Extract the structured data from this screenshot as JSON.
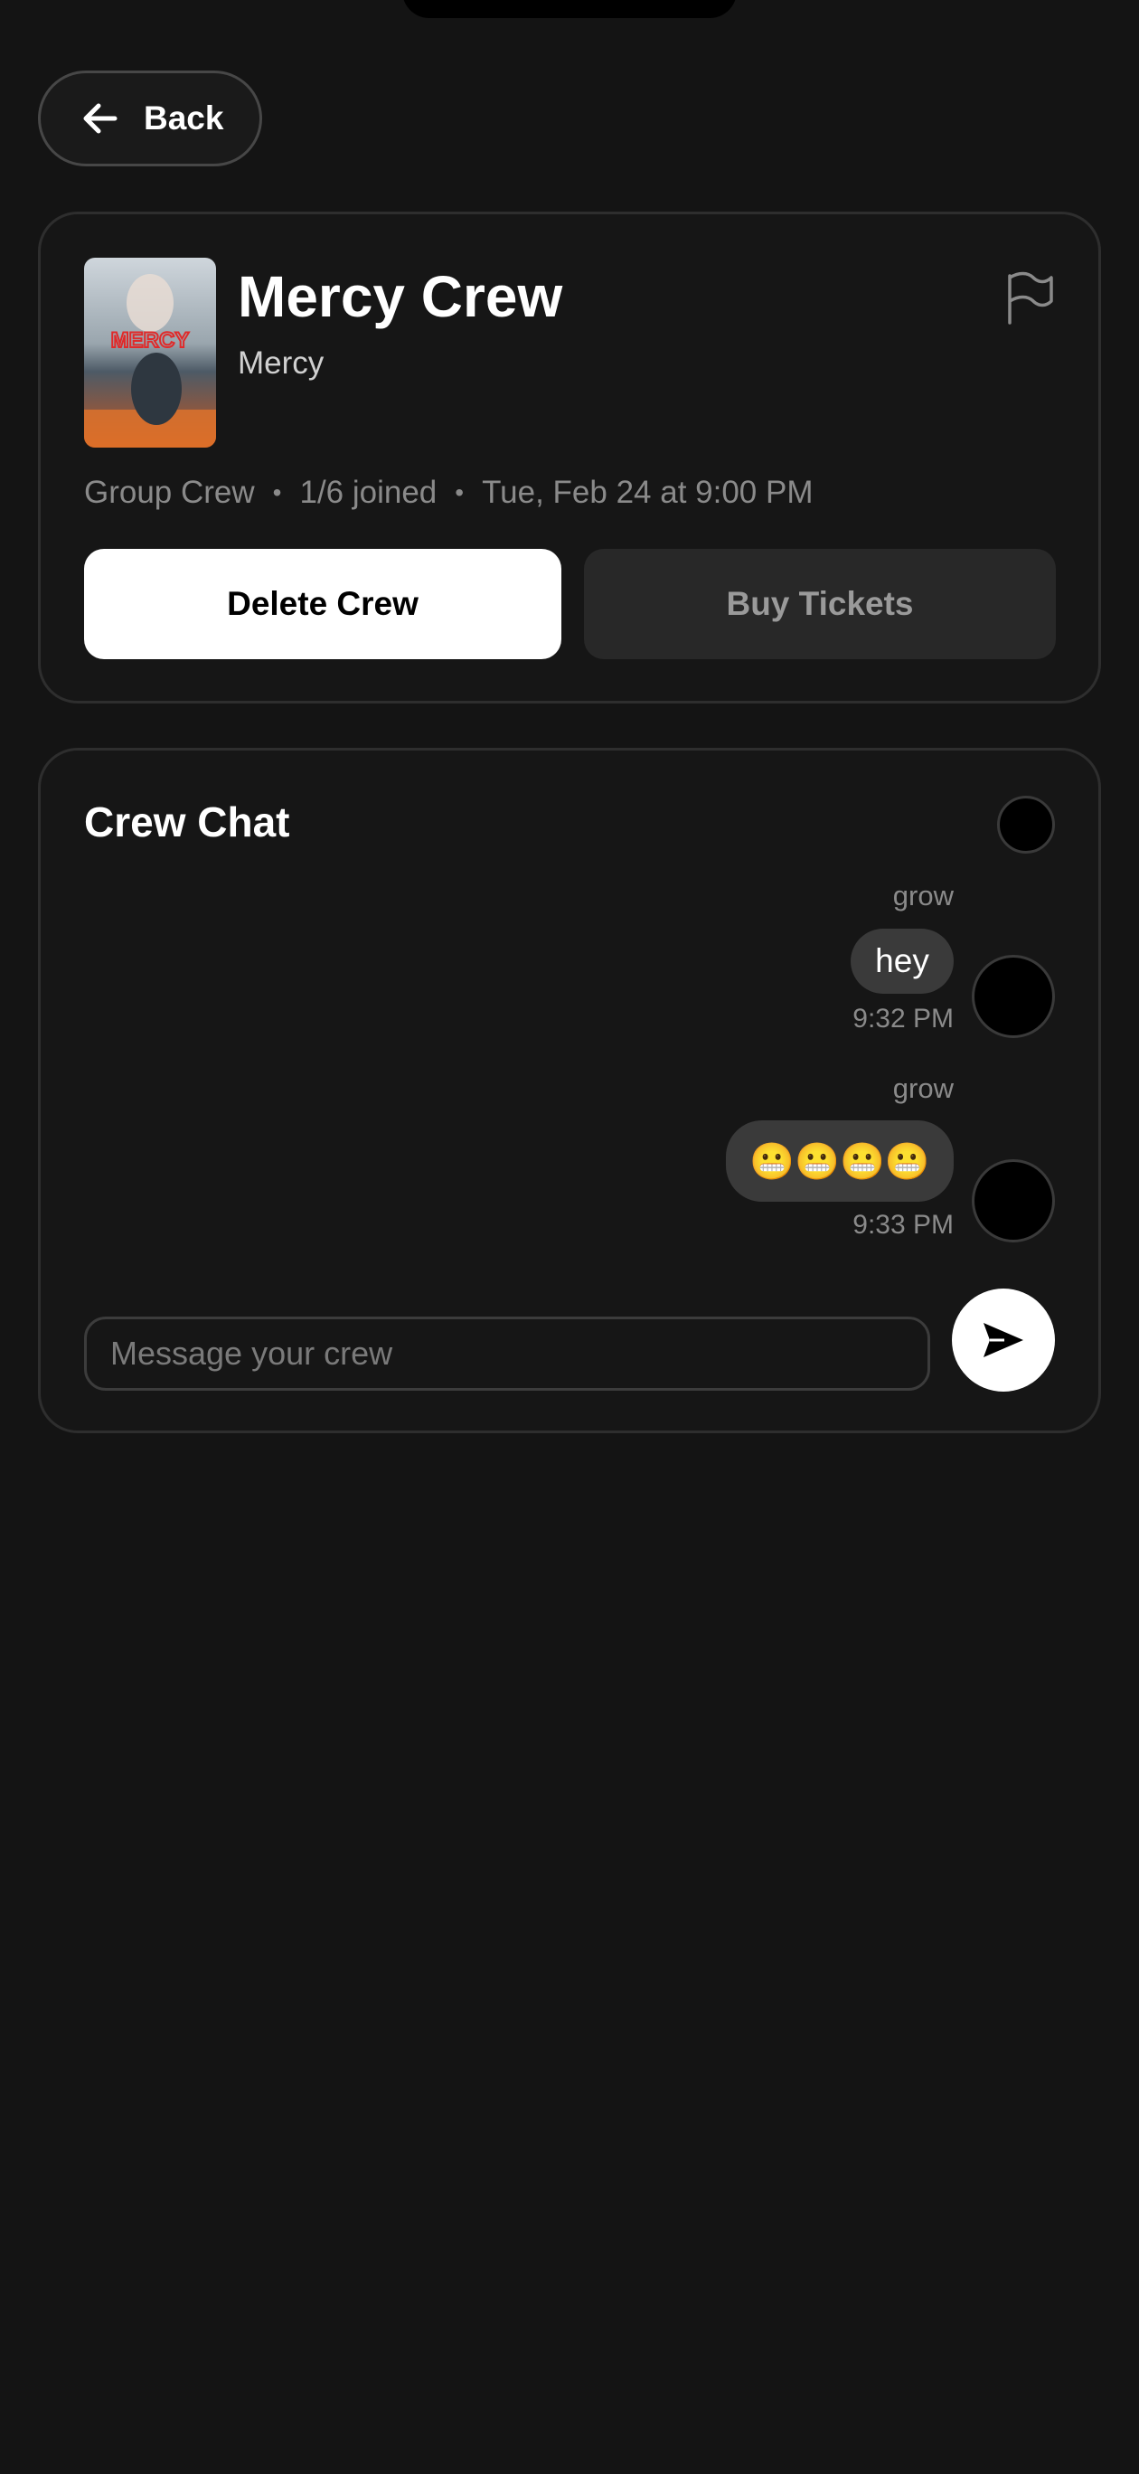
{
  "back": {
    "label": "Back",
    "icon": "arrow-left-icon"
  },
  "crew": {
    "title": "Mercy Crew",
    "movie": "Mercy",
    "poster_text": "MERCY",
    "type": "Group Crew",
    "joined": "1/6 joined",
    "showtime": "Tue, Feb 24 at 9:00 PM",
    "separator": "•",
    "flag_icon": "flag-icon"
  },
  "actions": {
    "delete_label": "Delete Crew",
    "buy_label": "Buy Tickets"
  },
  "chat": {
    "title": "Crew Chat",
    "messages": [
      {
        "sender": "grow",
        "text": "hey",
        "time": "9:32 PM"
      },
      {
        "sender": "grow",
        "text": "😬😬😬😬",
        "time": "9:33 PM"
      }
    ],
    "input_placeholder": "Message your crew",
    "input_value": "",
    "send_icon": "send-icon"
  },
  "colors": {
    "background": "#141414",
    "card": "#161616",
    "primary_button": "#ffffff",
    "secondary_button": "#282828",
    "bubble": "#3a3a3a",
    "muted_text": "#8a8a8a",
    "poster_accent": "#e02a2a"
  }
}
